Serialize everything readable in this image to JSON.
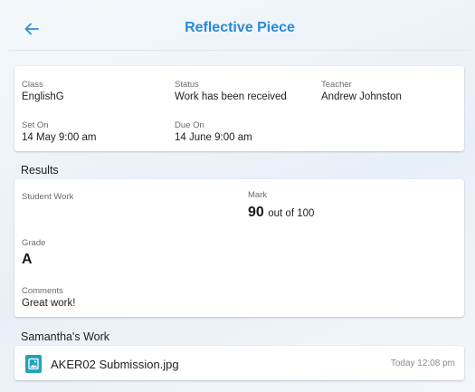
{
  "header": {
    "title": "Reflective Piece",
    "back_icon": "arrow-left-icon"
  },
  "details": {
    "class_label": "Class",
    "class_value": "EnglishG",
    "status_label": "Status",
    "status_value": "Work has been received",
    "teacher_label": "Teacher",
    "teacher_value": "Andrew Johnston",
    "set_on_label": "Set On",
    "set_on_value": "14 May 9:00 am",
    "due_on_label": "Due On",
    "due_on_value": "14 June 9:00 am"
  },
  "results": {
    "section_title": "Results",
    "student_work_label": "Student Work",
    "mark_label": "Mark",
    "mark_value": "90",
    "mark_suffix": "out of 100",
    "grade_label": "Grade",
    "grade_value": "A",
    "comments_label": "Comments",
    "comments_value": "Great work!"
  },
  "work": {
    "section_title": "Samantha's Work",
    "file_icon": "image-file-icon",
    "file_name": "AKER02 Submission.jpg",
    "file_time": "Today 12:08 pm"
  },
  "colors": {
    "accent": "#2a8ad8",
    "file_icon": "#22a3b8"
  }
}
